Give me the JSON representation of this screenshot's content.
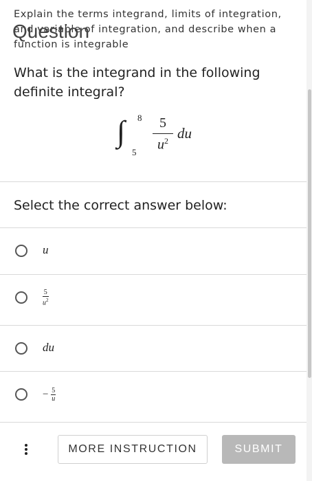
{
  "objective": "Explain the terms integrand, limits of integration, and variable of integration, and describe when a function is integrable",
  "section_label": "Question",
  "prompt": "What is the integrand in the following definite integral?",
  "integral": {
    "sign": "∫",
    "upper": "8",
    "lower": "5",
    "numerator": "5",
    "denominator_var": "u",
    "denominator_exp": "2",
    "differential": "du"
  },
  "select_label": "Select the correct answer below:",
  "options": [
    {
      "text": "u"
    },
    {
      "numerator": "5",
      "denominator_var": "u",
      "denominator_exp": "2"
    },
    {
      "text": "du"
    },
    {
      "sign": "−",
      "numerator": "5",
      "denominator_var": "u"
    }
  ],
  "buttons": {
    "more_instruction": "MORE INSTRUCTION",
    "submit": "SUBMIT"
  },
  "colors": {
    "submit_bg": "#b8b8b8",
    "divider": "#d9d9d9"
  }
}
